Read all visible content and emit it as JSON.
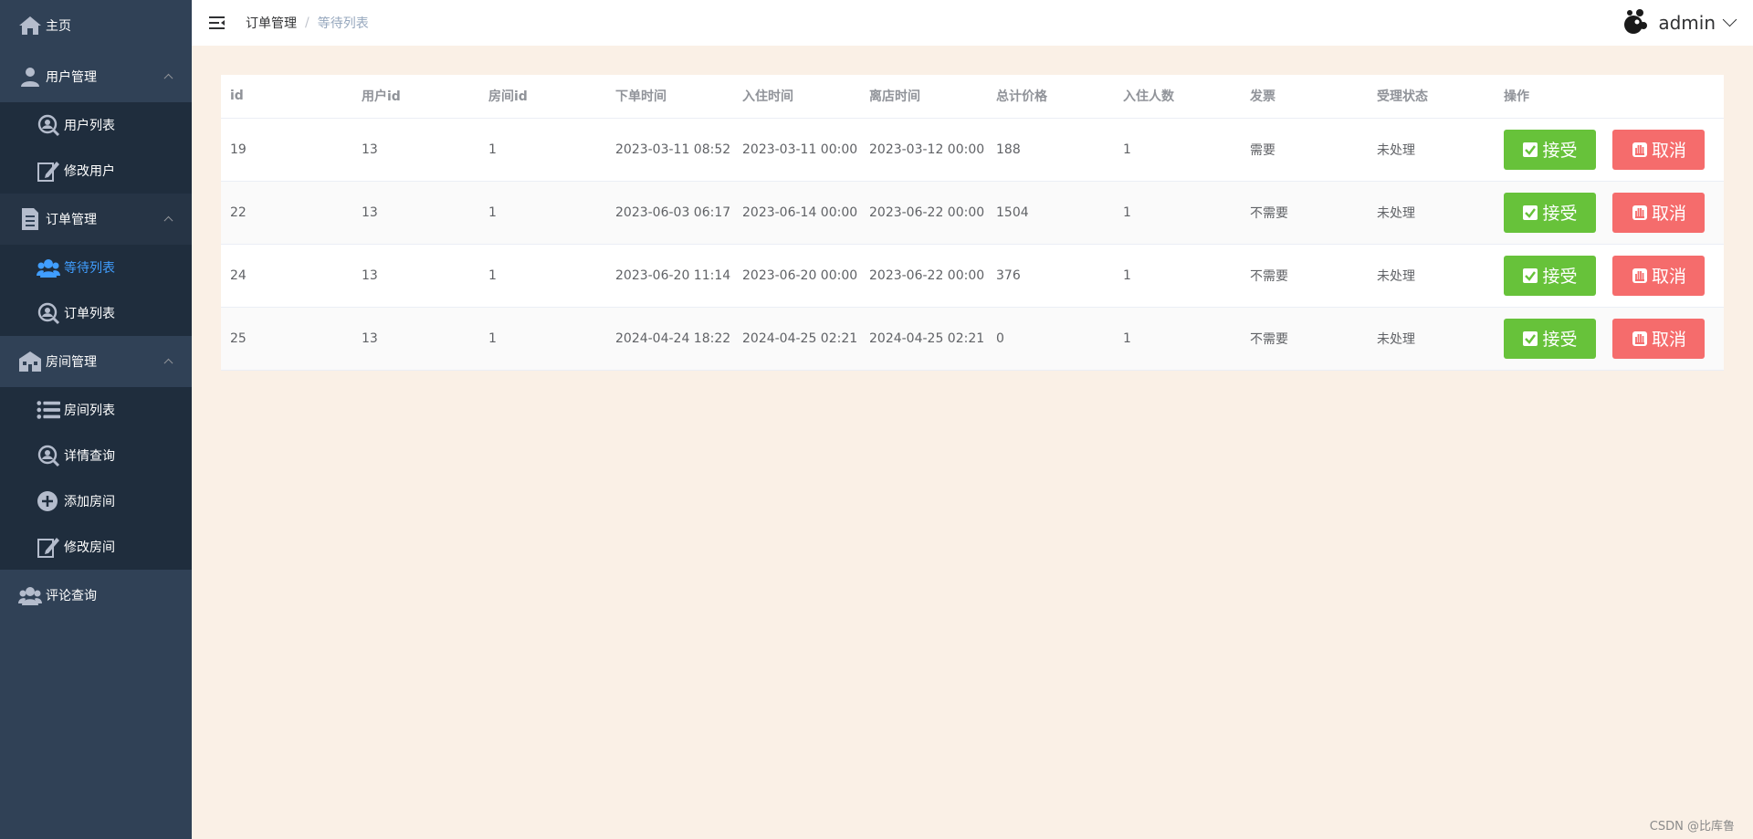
{
  "sidebar": {
    "home": "主页",
    "user_mgmt": {
      "label": "用户管理",
      "items": [
        "用户列表",
        "修改用户"
      ]
    },
    "order_mgmt": {
      "label": "订单管理",
      "items": [
        "等待列表",
        "订单列表"
      ]
    },
    "room_mgmt": {
      "label": "房间管理",
      "items": [
        "房间列表",
        "详情查询",
        "添加房间",
        "修改房间"
      ]
    },
    "comments": "评论查询"
  },
  "header": {
    "breadcrumb": [
      "订单管理",
      "等待列表"
    ],
    "separator": "/",
    "user": "admin"
  },
  "table": {
    "columns": [
      "id",
      "用户id",
      "房间id",
      "下单时间",
      "入住时间",
      "离店时间",
      "总计价格",
      "入住人数",
      "发票",
      "受理状态",
      "操作"
    ],
    "rows": [
      [
        "19",
        "13",
        "1",
        "2023-03-11 08:52",
        "2023-03-11 00:00",
        "2023-03-12 00:00",
        "188",
        "1",
        "需要",
        "未处理"
      ],
      [
        "22",
        "13",
        "1",
        "2023-06-03 06:17",
        "2023-06-14 00:00",
        "2023-06-22 00:00",
        "1504",
        "1",
        "不需要",
        "未处理"
      ],
      [
        "24",
        "13",
        "1",
        "2023-06-20 11:14",
        "2023-06-20 00:00",
        "2023-06-22 00:00",
        "376",
        "1",
        "不需要",
        "未处理"
      ],
      [
        "25",
        "13",
        "1",
        "2024-04-24 18:22",
        "2024-04-25 02:21",
        "2024-04-25 02:21",
        "0",
        "1",
        "不需要",
        "未处理"
      ]
    ],
    "accept_label": "接受",
    "cancel_label": "取消"
  },
  "watermark": "CSDN @比库鲁",
  "colors": {
    "sidebar": "#304156",
    "submenu": "#1f2d3d",
    "active": "#409eff",
    "accept": "#67c23a",
    "cancel": "#f56c6c",
    "background": "#faf0e6"
  }
}
